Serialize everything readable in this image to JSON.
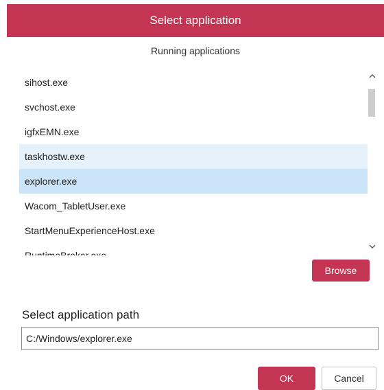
{
  "dialog": {
    "title": "Select application"
  },
  "running": {
    "label": "Running applications",
    "items": [
      {
        "label": "sihost.exe",
        "state": "normal"
      },
      {
        "label": "svchost.exe",
        "state": "normal"
      },
      {
        "label": "igfxEMN.exe",
        "state": "normal"
      },
      {
        "label": "taskhostw.exe",
        "state": "hovered"
      },
      {
        "label": "explorer.exe",
        "state": "selected"
      },
      {
        "label": "Wacom_TabletUser.exe",
        "state": "normal"
      },
      {
        "label": "StartMenuExperienceHost.exe",
        "state": "normal"
      },
      {
        "label": "RuntimeBroker.exe",
        "state": "normal"
      }
    ]
  },
  "browse_label": "Browse",
  "path": {
    "label": "Select application path",
    "value": "C:/Windows/explorer.exe"
  },
  "footer": {
    "ok_label": "OK",
    "cancel_label": "Cancel"
  },
  "colors": {
    "accent": "#c43453",
    "row_hover": "#e5f1fb",
    "row_selected": "#cce4f7"
  },
  "icons": {
    "scroll_up": "chevron-up-icon",
    "scroll_down": "chevron-down-icon"
  }
}
